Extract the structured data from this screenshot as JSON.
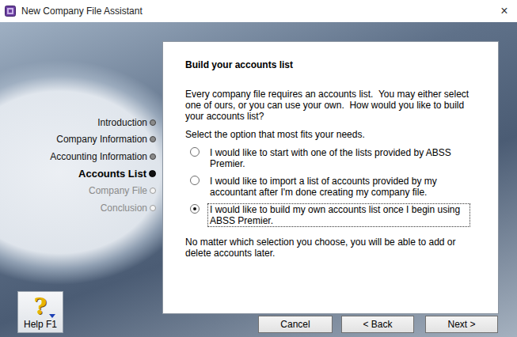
{
  "window": {
    "title": "New Company File Assistant",
    "close": "×"
  },
  "steps": [
    {
      "label": "Introduction",
      "state": "done"
    },
    {
      "label": "Company Information",
      "state": "done"
    },
    {
      "label": "Accounting Information",
      "state": "done"
    },
    {
      "label": "Accounts List",
      "state": "current"
    },
    {
      "label": "Company File",
      "state": "todo"
    },
    {
      "label": "Conclusion",
      "state": "todo"
    }
  ],
  "help": {
    "icon": "?",
    "label": "Help F1"
  },
  "panel": {
    "title": "Build your accounts list",
    "intro": "Every company file requires an accounts list.  You may either select one of ours, or you can use your own.  How would you like to build your accounts list?",
    "prompt": "Select the option that most fits your needs.",
    "options": [
      {
        "label": "I would like to start with one of the lists provided by ABSS Premier.",
        "selected": false,
        "focused": false
      },
      {
        "label": "I would like to import a list of accounts provided by my accountant after I'm done creating my company file.",
        "selected": false,
        "focused": false
      },
      {
        "label": "I would like to build my own accounts list once I begin using ABSS Premier.",
        "selected": true,
        "focused": true
      }
    ],
    "note": "No matter which selection you choose, you will be able to add or delete accounts later."
  },
  "buttons": [
    "Cancel",
    "< Back",
    "Next >"
  ]
}
